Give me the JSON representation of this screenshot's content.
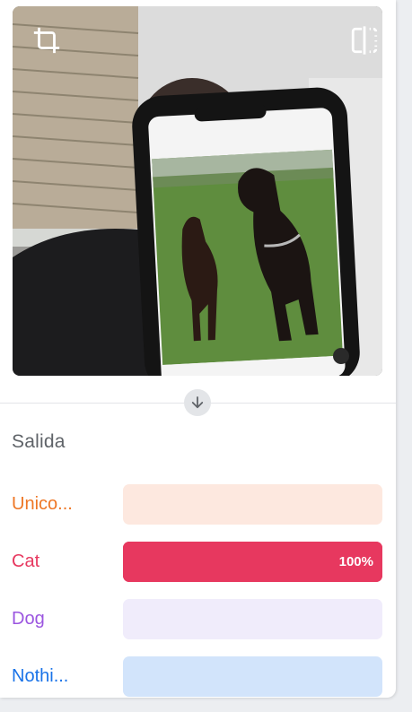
{
  "toolbar": {
    "crop_icon": "crop-icon",
    "flip_icon": "flip-horizontal-icon"
  },
  "preview": {
    "description_icon": "webcam-preview"
  },
  "arrow": {
    "icon": "arrow-down-icon"
  },
  "output": {
    "title": "Salida",
    "classes": [
      {
        "label": "Unico...",
        "color": "#ee7624",
        "track": "#fde8df",
        "confidence": 0,
        "percent_text": ""
      },
      {
        "label": "Cat",
        "color": "#e7385f",
        "track": "#e9395f",
        "confidence": 1.0,
        "percent_text": "100%"
      },
      {
        "label": "Dog",
        "color": "#9b55e0",
        "track": "#f0ecfb",
        "confidence": 0,
        "percent_text": ""
      },
      {
        "label": "Nothi...",
        "color": "#1a73e8",
        "track": "#d2e4fb",
        "confidence": 0,
        "percent_text": ""
      }
    ]
  }
}
